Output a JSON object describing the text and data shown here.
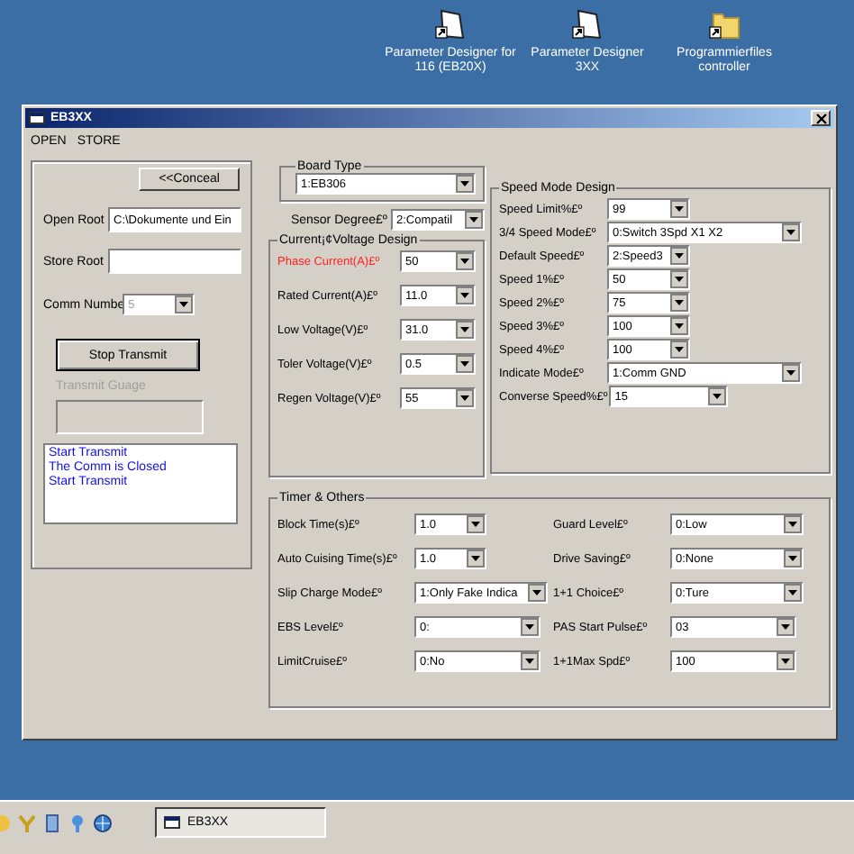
{
  "desktop_icons": [
    {
      "label": "Parameter Designer for 116 (EB20X)",
      "kind": "shortcut"
    },
    {
      "label": "Parameter Designer 3XX",
      "kind": "shortcut"
    },
    {
      "label": "Programmierfiles controller",
      "kind": "folder"
    }
  ],
  "window": {
    "title": "EB3XX",
    "menu": [
      "OPEN",
      "STORE"
    ]
  },
  "left_panel": {
    "conceal_button": "<<Conceal",
    "open_root": {
      "label": "Open Root",
      "value": "C:\\Dokumente und Ein"
    },
    "store_root": {
      "label": "Store Root"
    },
    "comm_number": {
      "label": "Comm Numbe",
      "value": "5",
      "disabled": true
    },
    "stop_button": "Stop Transmit",
    "gauge": {
      "label": "Transmit Guage",
      "disabled": true,
      "level": 0
    },
    "log": [
      "Start Transmit",
      "The Comm is Closed",
      "Start Transmit"
    ]
  },
  "board_type": {
    "title": "Board Type",
    "value": "1:EB306"
  },
  "sensor": {
    "label": "Sensor Degree£º",
    "value": "2:Compatil"
  },
  "current_voltage": {
    "title": "Current¡¢Voltage Design",
    "rows": [
      {
        "label": "Phase Current(A)£º",
        "value": "50",
        "highlighted": true
      },
      {
        "label": "Rated Current(A)£º",
        "value": "11.0",
        "highlighted": false
      },
      {
        "label": "Low Voltage(V)£º",
        "value": "31.0",
        "highlighted": false
      },
      {
        "label": "Toler Voltage(V)£º",
        "value": "0.5",
        "highlighted": false
      },
      {
        "label": "Regen Voltage(V)£º",
        "value": "55",
        "highlighted": false
      }
    ]
  },
  "speed_mode": {
    "title": "Speed Mode Design",
    "rows": [
      {
        "label": "Speed Limit%£º",
        "value": "99",
        "kind": "short"
      },
      {
        "label": "3/4 Speed Mode£º",
        "value": "0:Switch 3Spd X1 X2",
        "kind": "long"
      },
      {
        "label": "Default Speed£º",
        "value": "2:Speed3",
        "kind": "short"
      },
      {
        "label": "Speed 1%£º",
        "value": "50",
        "kind": "short"
      },
      {
        "label": "Speed 2%£º",
        "value": "75",
        "kind": "short"
      },
      {
        "label": "Speed 3%£º",
        "value": "100",
        "kind": "short"
      },
      {
        "label": "Speed 4%£º",
        "value": "100",
        "kind": "short"
      },
      {
        "label": "Indicate Mode£º",
        "value": "1:Comm GND",
        "kind": "long"
      },
      {
        "label": "Converse Speed%£º",
        "value": "15",
        "kind": "medium"
      }
    ]
  },
  "timer_others": {
    "title": "Timer & Others",
    "rows": [
      {
        "label": "Block Time(s)£º",
        "value": "1.0",
        "kind": "short"
      },
      {
        "label": "Guard Level£º",
        "value": "0:Low",
        "kind": "medium"
      },
      {
        "label": "Auto Cuising Time(s)£º",
        "value": "1.0",
        "kind": "short"
      },
      {
        "label": "Drive Saving£º",
        "value": "0:None",
        "kind": "medium"
      },
      {
        "label": "Slip Charge Mode£º",
        "value": "1:Only Fake Indica",
        "kind": "medium"
      },
      {
        "label": "1+1 Choice£º",
        "value": "0:Ture",
        "kind": "medium"
      },
      {
        "label": "EBS Level£º",
        "value": "0:",
        "kind": "long"
      },
      {
        "label": "PAS Start Pulse£º",
        "value": "03",
        "kind": "long"
      },
      {
        "label": "LimitCruise£º",
        "value": "0:No",
        "kind": "long"
      },
      {
        "label": "1+1Max Spd£º",
        "value": "100",
        "kind": "long"
      }
    ]
  },
  "taskbar": {
    "tasks": [
      "EB3XX"
    ]
  }
}
